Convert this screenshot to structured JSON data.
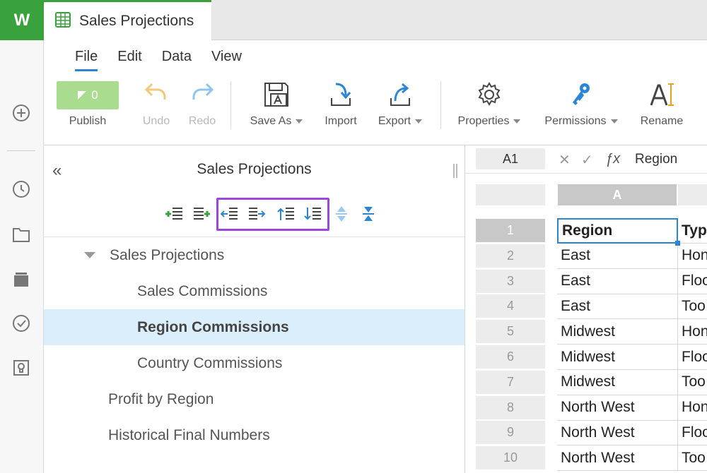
{
  "app": {
    "logo": "W"
  },
  "tab": {
    "title": "Sales Projections"
  },
  "menu": [
    "File",
    "Edit",
    "Data",
    "View"
  ],
  "toolbar": {
    "publish": {
      "label": "Publish",
      "count": "0"
    },
    "undo": "Undo",
    "redo": "Redo",
    "save_as": "Save As",
    "import": "Import",
    "export": "Export",
    "properties": "Properties",
    "permissions": "Permissions",
    "rename": "Rename"
  },
  "panel": {
    "title": "Sales Projections",
    "collapse_glyph": "«",
    "tree": [
      {
        "label": "Sales Projections",
        "level": 0,
        "expanded": true,
        "selected": false
      },
      {
        "label": "Sales Commissions",
        "level": 1,
        "selected": false
      },
      {
        "label": "Region Commissions",
        "level": 1,
        "selected": true
      },
      {
        "label": "Country Commissions",
        "level": 1,
        "selected": false
      },
      {
        "label": "Profit by Region",
        "level": 0,
        "selected": false
      },
      {
        "label": "Historical Final Numbers",
        "level": 0,
        "selected": false
      }
    ]
  },
  "sheet": {
    "cell_ref": "A1",
    "formula_value": "Region",
    "columns": [
      "A",
      ""
    ],
    "rows": [
      {
        "n": "1",
        "a": "Region",
        "b": "Typ"
      },
      {
        "n": "2",
        "a": "East",
        "b": "Hon"
      },
      {
        "n": "3",
        "a": "East",
        "b": "Floo"
      },
      {
        "n": "4",
        "a": "East",
        "b": "Too"
      },
      {
        "n": "5",
        "a": "Midwest",
        "b": "Hon"
      },
      {
        "n": "6",
        "a": "Midwest",
        "b": "Floo"
      },
      {
        "n": "7",
        "a": "Midwest",
        "b": "Too"
      },
      {
        "n": "8",
        "a": "North West",
        "b": "Hon"
      },
      {
        "n": "9",
        "a": "North West",
        "b": "Floo"
      },
      {
        "n": "10",
        "a": "North West",
        "b": "Too"
      }
    ]
  },
  "colors": {
    "accent": "#2a86d4",
    "brand": "#3aa23c",
    "highlight": "#9d46d9",
    "selection": "#dbeefc"
  }
}
